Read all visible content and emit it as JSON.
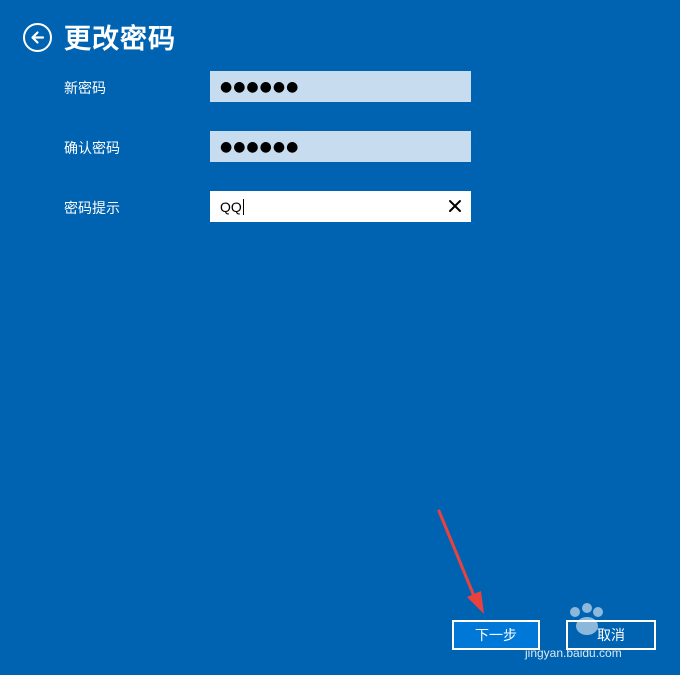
{
  "header": {
    "title": "更改密码",
    "back_icon": "back-arrow-icon"
  },
  "form": {
    "new_password": {
      "label": "新密码",
      "value": "●●●●●●"
    },
    "confirm_password": {
      "label": "确认密码",
      "value": "●●●●●●"
    },
    "password_hint": {
      "label": "密码提示",
      "value": "QQ",
      "clear_icon": "close-icon"
    }
  },
  "buttons": {
    "next_label": "下一步",
    "cancel_label": "取消"
  },
  "watermark": {
    "text": "jingyan.baidu.com"
  },
  "colors": {
    "background": "#0063b1",
    "primary_button": "#0078d7",
    "masked_field": "#c7dcee",
    "annotation_arrow": "#e8423f"
  }
}
